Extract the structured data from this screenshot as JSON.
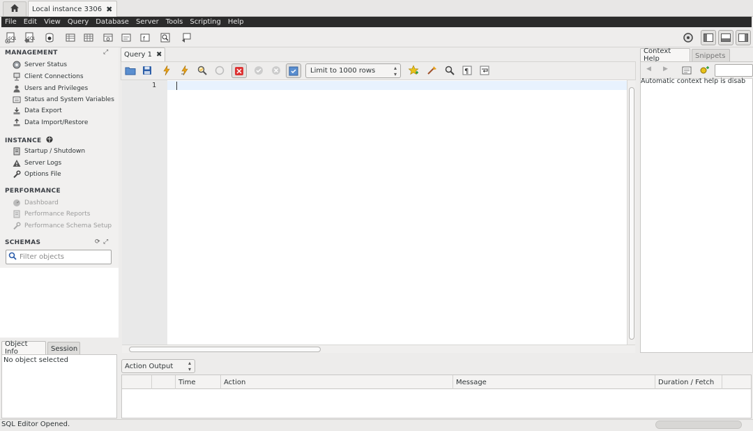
{
  "tabs": {
    "home_icon": "home-icon",
    "connection": {
      "label": "Local instance 3306",
      "close": "✖"
    }
  },
  "menubar": [
    "File",
    "Edit",
    "View",
    "Query",
    "Database",
    "Server",
    "Tools",
    "Scripting",
    "Help"
  ],
  "sidebar": {
    "management": {
      "title": "MANAGEMENT",
      "items": [
        {
          "label": "Server Status",
          "icon": "server-status-icon"
        },
        {
          "label": "Client Connections",
          "icon": "client-connections-icon"
        },
        {
          "label": "Users and Privileges",
          "icon": "users-icon"
        },
        {
          "label": "Status and System Variables",
          "icon": "variables-icon"
        },
        {
          "label": "Data Export",
          "icon": "data-export-icon"
        },
        {
          "label": "Data Import/Restore",
          "icon": "data-import-icon"
        }
      ]
    },
    "instance": {
      "title": "INSTANCE",
      "items": [
        {
          "label": "Startup / Shutdown",
          "icon": "startup-icon"
        },
        {
          "label": "Server Logs",
          "icon": "warning-icon"
        },
        {
          "label": "Options File",
          "icon": "wrench-icon"
        }
      ]
    },
    "performance": {
      "title": "PERFORMANCE",
      "items": [
        {
          "label": "Dashboard",
          "icon": "dashboard-icon"
        },
        {
          "label": "Performance Reports",
          "icon": "reports-icon"
        },
        {
          "label": "Performance Schema Setup",
          "icon": "schema-setup-icon"
        }
      ]
    },
    "schemas": {
      "title": "SCHEMAS",
      "filter_placeholder": "Filter objects"
    },
    "object_tabs": [
      "Object Info",
      "Session"
    ],
    "object_info_text": "No object selected"
  },
  "query": {
    "tab_label": "Query 1",
    "tab_close": "✖",
    "limit": "Limit to 1000 rows",
    "line_number": "1"
  },
  "right_panel": {
    "tabs": [
      "Context Help",
      "Snippets"
    ],
    "help_text": "Automatic context help is disab"
  },
  "output": {
    "selector": "Action Output",
    "columns": [
      "",
      "Time",
      "Action",
      "Message",
      "Duration / Fetch"
    ]
  },
  "status": {
    "text": "SQL Editor Opened."
  },
  "colors": {
    "menubar_bg": "#2b2b2b",
    "current_line": "#e8f2fe",
    "accent_orange": "#e8a21a",
    "stop_red": "#d33"
  }
}
